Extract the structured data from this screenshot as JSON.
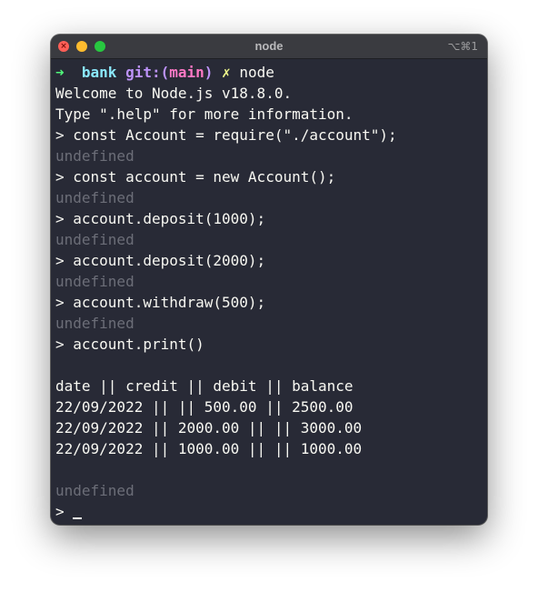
{
  "window": {
    "title": "node",
    "shortcut": "⌥⌘1"
  },
  "prompt": {
    "arrow": "➜",
    "dir": "bank",
    "git_prefix": "git:(",
    "branch": "main",
    "git_suffix": ")",
    "dirty": "✗",
    "command": "node"
  },
  "output": {
    "welcome": "Welcome to Node.js v18.8.0.",
    "help": "Type \".help\" for more information."
  },
  "repl": {
    "cmd1": "> const Account = require(\"./account\");",
    "res1": "undefined",
    "cmd2": "> const account = new Account();",
    "res2": "undefined",
    "cmd3": "> account.deposit(1000);",
    "res3": "undefined",
    "cmd4": "> account.deposit(2000);",
    "res4": "undefined",
    "cmd5": "> account.withdraw(500);",
    "res5": "undefined",
    "cmd6": "> account.print()"
  },
  "statement": {
    "header": "date || credit || debit || balance",
    "rows": [
      "22/09/2022 || || 500.00 || 2500.00",
      "22/09/2022 || 2000.00 || || 3000.00",
      "22/09/2022 || 1000.00 || || 1000.00"
    ]
  },
  "final": {
    "result": "undefined",
    "prompt": ">"
  },
  "colors": {
    "background": "#282a36",
    "arrow": "#50fa7b",
    "dir": "#8be9fd",
    "git": "#bd93f9",
    "branch": "#ff79c6",
    "dirty": "#f1fa8c",
    "dim": "#6c6e78"
  }
}
